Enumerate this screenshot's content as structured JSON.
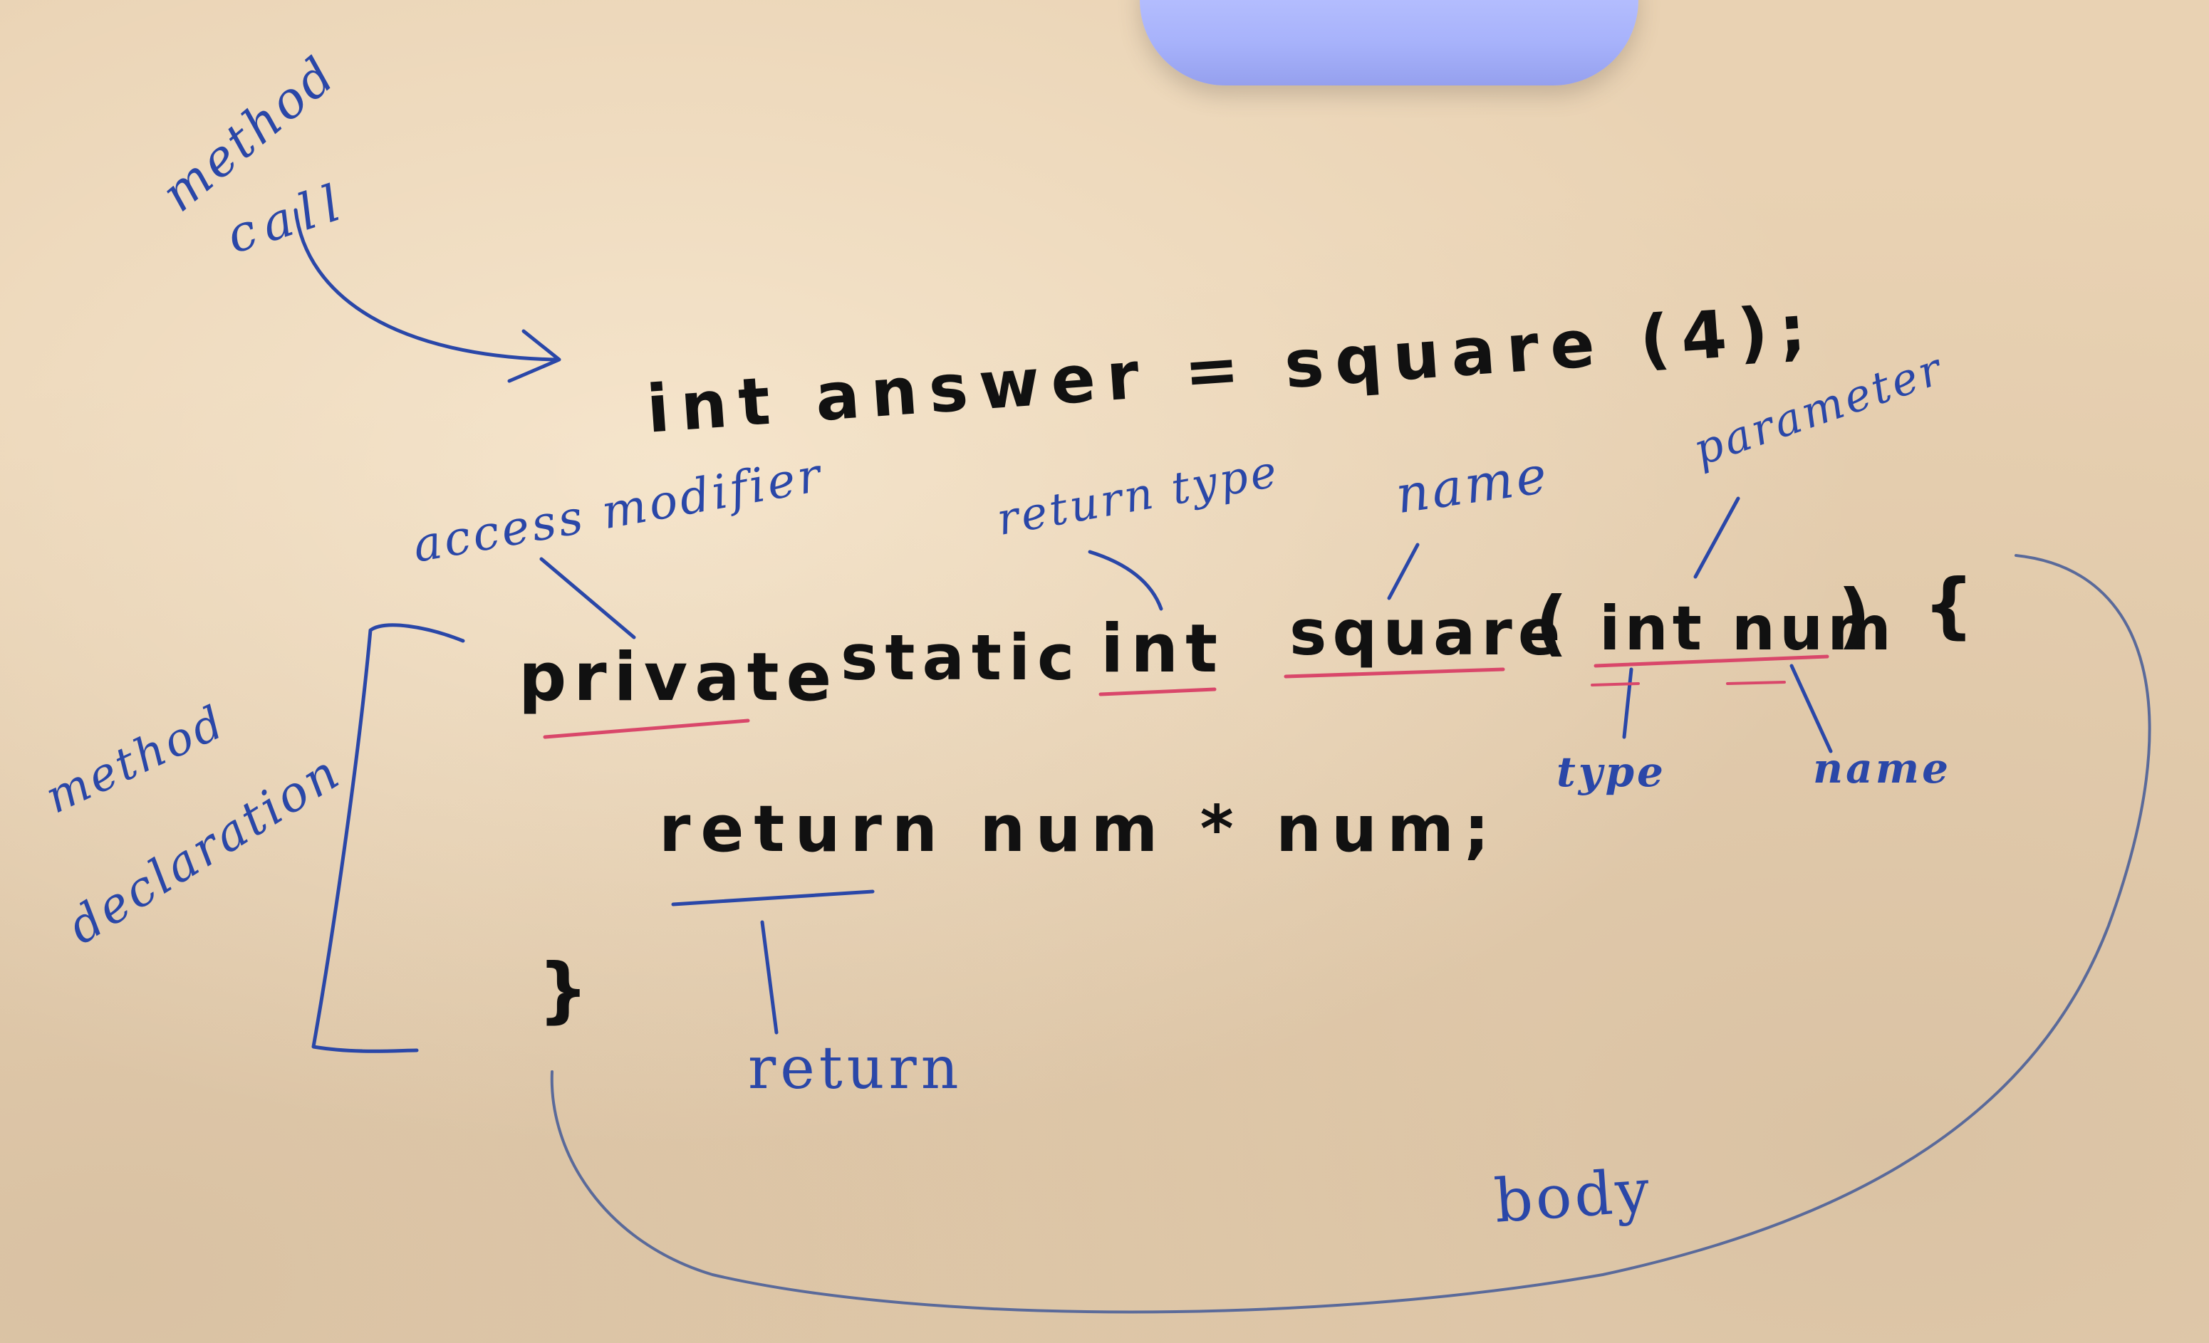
{
  "code": {
    "call_line": "int answer = square (4);",
    "decl_private": "private",
    "decl_static": "static",
    "decl_int": "int",
    "decl_square": "square",
    "decl_paren_open": "(",
    "decl_param": "int num",
    "decl_paren_close": ")",
    "decl_brace_open": "{",
    "body_line": "return num * num;",
    "brace_close": "}"
  },
  "annotations": {
    "method_call_line1": "method",
    "method_call_line2": "call",
    "access_modifier": "access modifier",
    "return_type": "return type",
    "name": "name",
    "parameter": "parameter",
    "param_type": "type",
    "param_name": "name",
    "method_declaration_line1": "method",
    "method_declaration_line2": "declaration",
    "return": "return",
    "body": "body"
  },
  "colors": {
    "background": "#e9d2b3",
    "code_ink": "#111111",
    "annotation_ink": "#2a47a8",
    "underline_red": "#d9476a",
    "cup": "#a7b2fb"
  }
}
